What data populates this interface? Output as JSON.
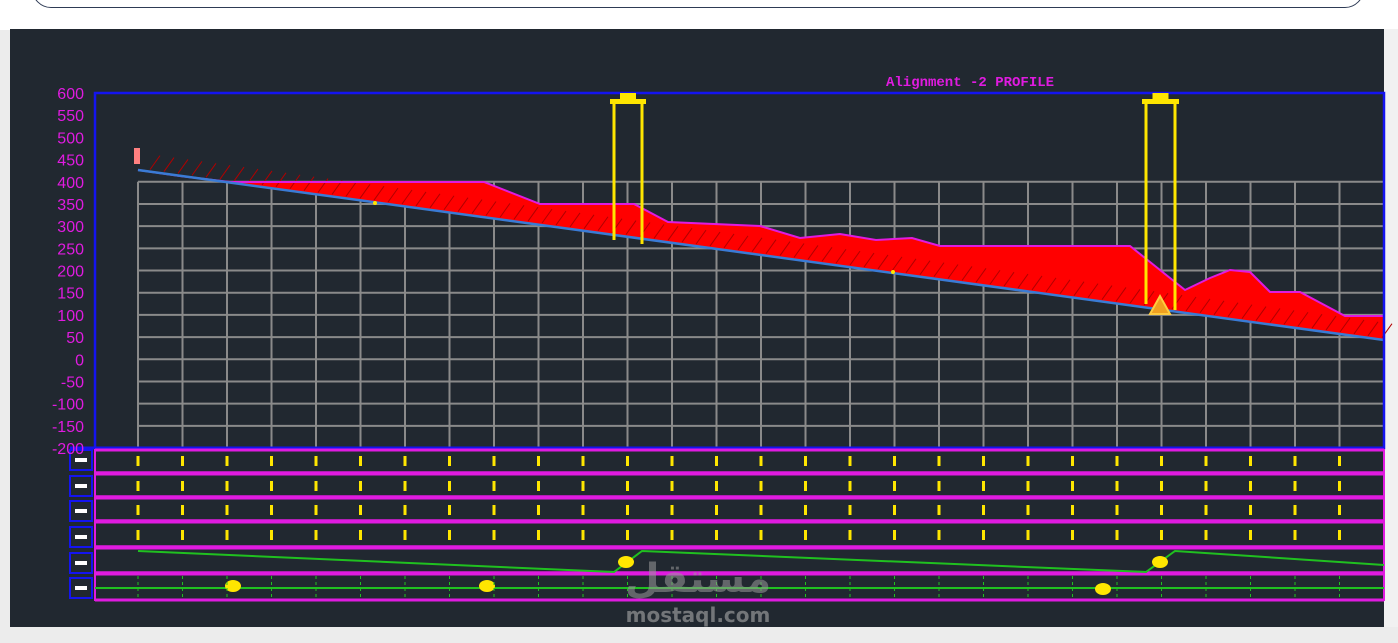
{
  "profile": {
    "title": "Alignment -2 PROFILE",
    "y_axis": {
      "ticks": [
        "600",
        "550",
        "500",
        "450",
        "400",
        "350",
        "300",
        "250",
        "200",
        "150",
        "100",
        "50",
        "0",
        "-50",
        "-100",
        "-150",
        "-200"
      ],
      "min": -200,
      "max": 600,
      "step": 50
    },
    "colors": {
      "background": "#212830",
      "frame": "#1414f0",
      "grid": "#8a8a8a",
      "labels": "#e01be0",
      "fill": "#ff0000",
      "ground_line": "#3a7bd5",
      "structure": "#ffe600",
      "band_lines": "#e01be0",
      "green_line": "#20c020"
    }
  },
  "watermark": {
    "arabic": "مستقل",
    "latin": "mostaql.com"
  }
}
